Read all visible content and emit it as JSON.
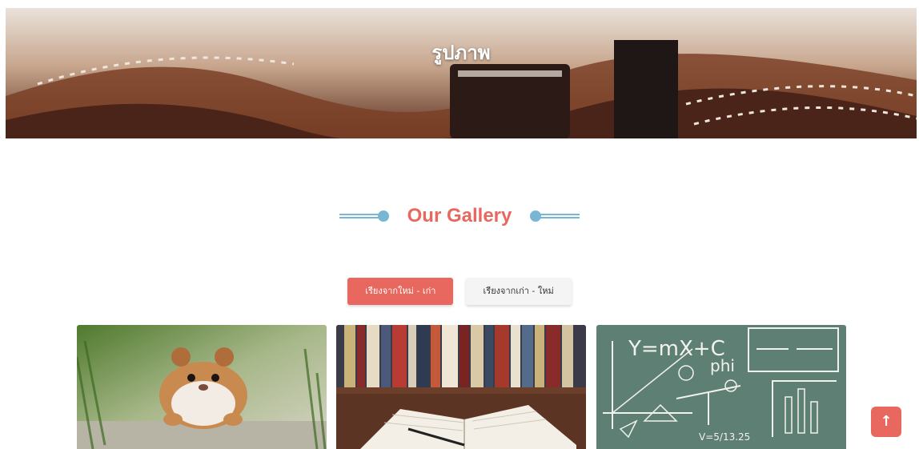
{
  "hero": {
    "title": "รูปภาพ"
  },
  "gallery": {
    "heading": "Our Gallery",
    "sort_buttons": [
      {
        "label": "เรียงจากใหม่ - เก่า",
        "active": true
      },
      {
        "label": "เรียงจากเก่า - ใหม่",
        "active": false
      }
    ],
    "cards": [
      {
        "image": "hamster-photo"
      },
      {
        "image": "book-library-photo"
      },
      {
        "image": "chalkboard-math-photo",
        "chalk_text": [
          "Y=mX+C",
          "phi",
          "V=5/13.25"
        ]
      }
    ]
  },
  "back_to_top": {
    "icon": "arrow-up-icon",
    "glyph": "↑"
  },
  "colors": {
    "accent": "#e8685f",
    "decor": "#79b6d4"
  }
}
